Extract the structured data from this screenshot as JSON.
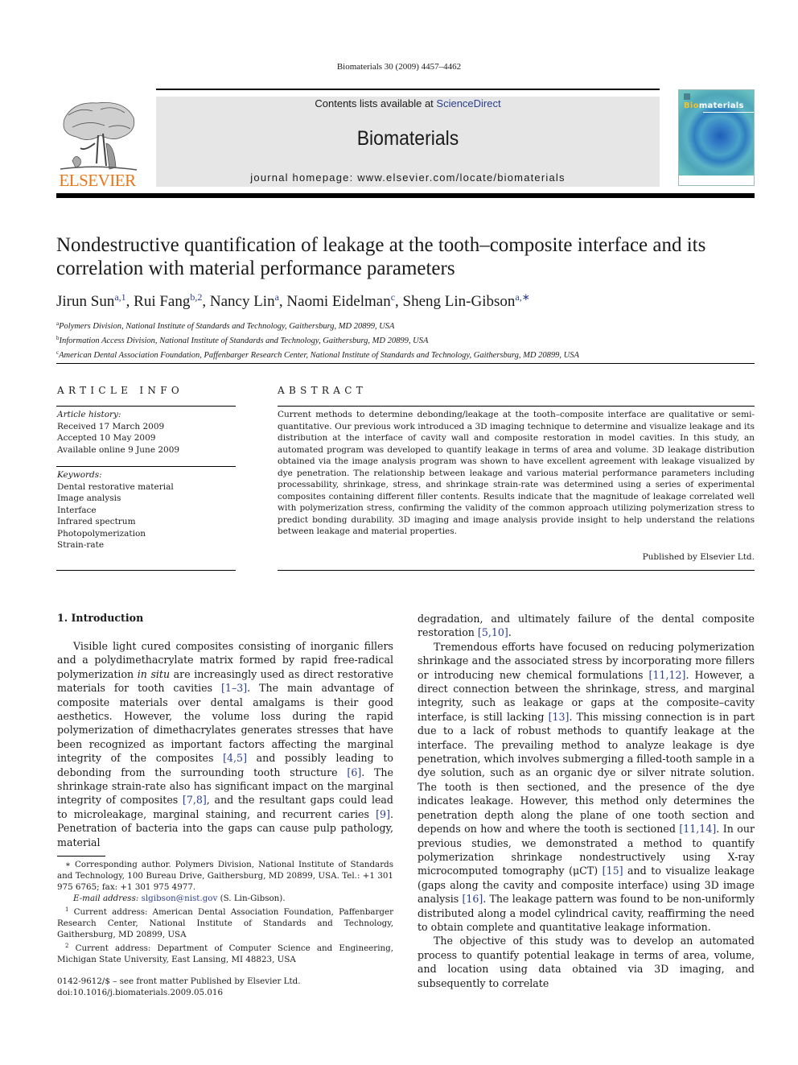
{
  "running_head": "Biomaterials 30 (2009) 4457–4462",
  "publisher": {
    "logo_icon": "elsevier-tree-icon",
    "name": "ELSEVIER"
  },
  "banner": {
    "contents_prefix": "Contents lists available at ",
    "contents_link": "ScienceDirect",
    "journal_name": "Biomaterials",
    "homepage": "journal homepage: www.elsevier.com/locate/biomaterials"
  },
  "cover": {
    "title_highlight": "Bio",
    "title_rest": "materials",
    "colors": {
      "highlight": "#f5c02a",
      "background": "#3a86c8"
    }
  },
  "article": {
    "title": "Nondestructive quantification of leakage at the tooth–composite interface and its correlation with material performance parameters",
    "authors": [
      {
        "name": "Jirun Sun",
        "sup": "a,1"
      },
      {
        "name": "Rui Fang",
        "sup": "b,2"
      },
      {
        "name": "Nancy Lin",
        "sup": "a"
      },
      {
        "name": "Naomi Eidelman",
        "sup": "c"
      },
      {
        "name": "Sheng Lin-Gibson",
        "sup": "a,∗"
      }
    ],
    "affiliations": [
      {
        "key": "a",
        "text": "Polymers Division, National Institute of Standards and Technology, Gaithersburg, MD 20899, USA"
      },
      {
        "key": "b",
        "text": "Information Access Division, National Institute of Standards and Technology, Gaithersburg, MD 20899, USA"
      },
      {
        "key": "c",
        "text": "American Dental Association Foundation, Paffenbarger Research Center, National Institute of Standards and Technology, Gaithersburg, MD 20899, USA"
      }
    ]
  },
  "article_info": {
    "heading": "ARTICLE INFO",
    "history_label": "Article history:",
    "history": [
      "Received 17 March 2009",
      "Accepted 10 May 2009",
      "Available online 9 June 2009"
    ],
    "keywords_label": "Keywords:",
    "keywords": [
      "Dental restorative material",
      "Image analysis",
      "Interface",
      "Infrared spectrum",
      "Photopolymerization",
      "Strain-rate"
    ]
  },
  "abstract": {
    "heading": "ABSTRACT",
    "text": "Current methods to determine debonding/leakage at the tooth–composite interface are qualitative or semi-quantitative. Our previous work introduced a 3D imaging technique to determine and visualize leakage and its distribution at the interface of cavity wall and composite restoration in model cavities. In this study, an automated program was developed to quantify leakage in terms of area and volume. 3D leakage distribution obtained via the image analysis program was shown to have excellent agreement with leakage visualized by dye penetration. The relationship between leakage and various material performance parameters including processability, shrinkage, stress, and shrinkage strain-rate was determined using a series of experimental composites containing different filler contents. Results indicate that the magnitude of leakage correlated well with polymerization stress, confirming the validity of the common approach utilizing polymerization stress to predict bonding durability. 3D imaging and image analysis provide insight to help understand the relations between leakage and material properties.",
    "published_by": "Published by Elsevier Ltd."
  },
  "introduction": {
    "heading": "1.  Introduction",
    "p1": {
      "s1": "Visible light cured composites consisting of inorganic fillers and a polydimethacrylate matrix formed by rapid free-radical polymerization ",
      "s1_italic": "in situ",
      "s2": " are increasingly used as direct restorative materials for tooth cavities ",
      "c1": "[1–3]",
      "s3": ". The main advantage of composite materials over dental amalgams is their good aesthetics. However, the volume loss during the rapid polymerization of dimethacrylates generates stresses that have been recognized as important factors affecting the marginal integrity of the composites ",
      "c2": "[4,5]",
      "s4": " and possibly leading to debonding from the surrounding tooth structure ",
      "c3": "[6]",
      "s5": ". The shrinkage strain-rate also has significant impact on the marginal integrity of composites ",
      "c4": "[7,8]",
      "s6": ", and the resultant gaps could lead to microleakage, marginal staining, and recurrent caries ",
      "c5": "[9]",
      "s7": ". Penetration of bacteria into the gaps can cause pulp pathology, material degradation, and ultimately failure of the dental composite restoration ",
      "c6": "[5,10]",
      "s8": "."
    },
    "p2": {
      "s1": "Tremendous efforts have focused on reducing polymerization shrinkage and the associated stress by incorporating more fillers or introducing new chemical formulations ",
      "c1": "[11,12]",
      "s2": ". However, a direct connection between the shrinkage, stress, and marginal integrity, such as leakage or gaps at the composite–cavity interface, is still lacking ",
      "c2": "[13]",
      "s3": ". This missing connection is in part due to a lack of robust methods to quantify leakage at the interface. The prevailing method to analyze leakage is dye penetration, which involves submerging a filled-tooth sample in a dye solution, such as an organic dye or silver nitrate solution. The tooth is then sectioned, and the presence of the dye indicates leakage. However, this method only determines the penetration depth along the plane of one tooth section and depends on how and where the tooth is sectioned ",
      "c3": "[11,14]",
      "s4": ". In our previous studies, we demonstrated a method to quantify polymerization shrinkage nondestructively using X-ray microcomputed tomography (μCT) ",
      "c4": "[15]",
      "s5": " and to visualize leakage (gaps along the cavity and composite interface) using 3D image analysis ",
      "c5": "[16]",
      "s6": ". The leakage pattern was found to be non-uniformly distributed along a model cylindrical cavity, reaffirming the need to obtain complete and quantitative leakage information."
    },
    "p3": "The objective of this study was to develop an automated process to quantify potential leakage in terms of area, volume, and location using data obtained via 3D imaging, and subsequently to correlate"
  },
  "footnotes": {
    "corresponding": "∗ Corresponding author. Polymers Division, National Institute of Standards and Technology, 100 Bureau Drive, Gaithersburg, MD 20899, USA. Tel.: +1 301 975 6765; fax: +1 301 975 4977.",
    "email_label": "E-mail address: ",
    "email": "slgibson@nist.gov",
    "email_suffix": " (S. Lin-Gibson).",
    "fn1_mark": "1",
    "fn1": " Current address: American Dental Association Foundation, Paffenbarger Research Center, National Institute of Standards and Technology, Gaithersburg, MD 20899, USA",
    "fn2_mark": "2",
    "fn2": " Current address: Department of Computer Science and Engineering, Michigan State University, East Lansing, MI 48823, USA"
  },
  "copyright": {
    "line1": "0142-9612/$ – see front matter Published by Elsevier Ltd.",
    "line2": "doi:10.1016/j.biomaterials.2009.05.016"
  }
}
